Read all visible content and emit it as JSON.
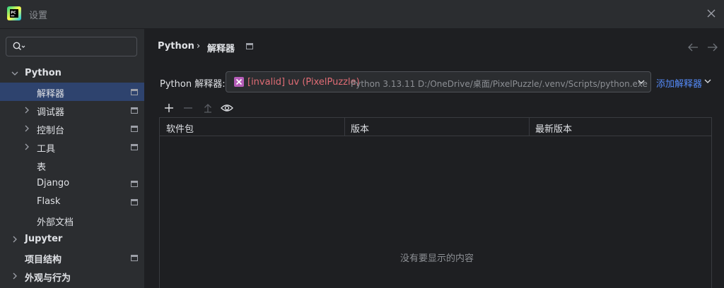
{
  "window": {
    "title": "设置"
  },
  "search": {
    "value": "",
    "placeholder": ""
  },
  "sidebar": {
    "items": [
      {
        "label": "Python"
      },
      {
        "label": "解释器"
      },
      {
        "label": "调试器"
      },
      {
        "label": "控制台"
      },
      {
        "label": "工具"
      },
      {
        "label": "表"
      },
      {
        "label": "Django"
      },
      {
        "label": "Flask"
      },
      {
        "label": "外部文档"
      },
      {
        "label": "Jupyter"
      },
      {
        "label": "项目结构"
      },
      {
        "label": "外观与行为"
      }
    ]
  },
  "header": {
    "breadcrumb_parent": "Python",
    "breadcrumb_sep": "›",
    "breadcrumb_current": "解释器"
  },
  "interpreter": {
    "label": "Python 解释器:",
    "invalid_text": "[invalid] uv (PixelPuzzle)",
    "detail_text": "Python 3.13.11 D:/OneDrive/桌面/PixelPuzzle/.venv/Scripts/python.exe",
    "add_label": "添加解释器"
  },
  "table": {
    "columns": [
      "软件包",
      "版本",
      "最新版本"
    ],
    "empty_message": "没有要显示的内容"
  },
  "colors": {
    "accent": "#548af7",
    "invalid": "#e06c75",
    "selected": "#2e436e"
  }
}
